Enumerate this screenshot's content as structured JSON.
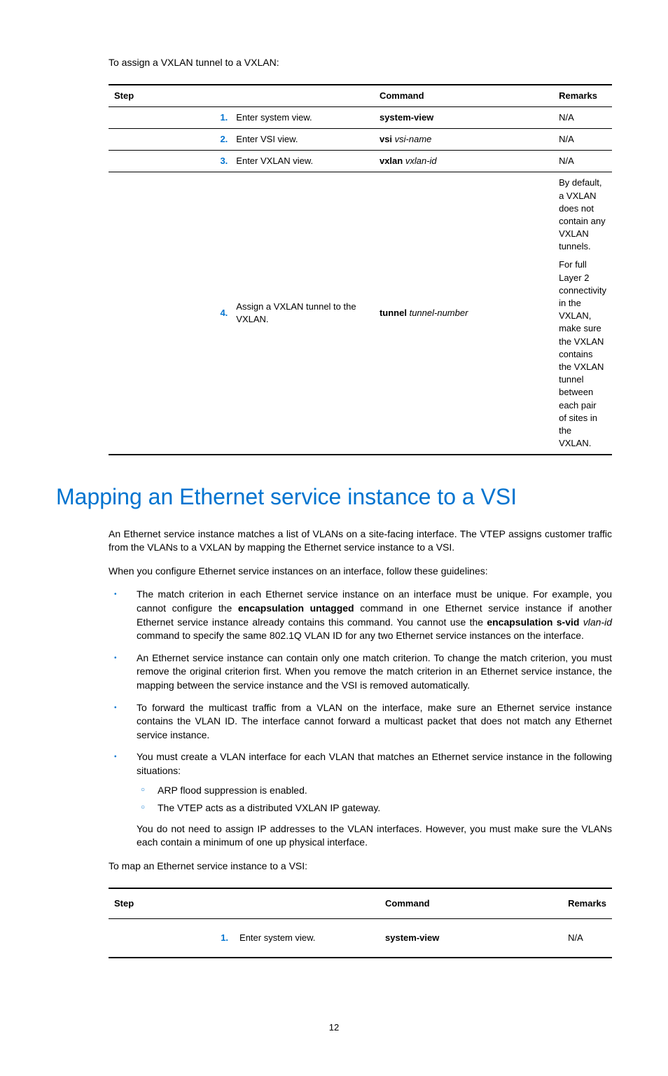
{
  "intro_text_1": "To assign a VXLAN tunnel to a VXLAN:",
  "table1": {
    "headers": {
      "step": "Step",
      "command": "Command",
      "remarks": "Remarks"
    },
    "rows": [
      {
        "num": "1.",
        "desc": "Enter system view.",
        "cmd_bold": "system-view",
        "cmd_italic": "",
        "remarks": "N/A"
      },
      {
        "num": "2.",
        "desc": "Enter VSI view.",
        "cmd_bold": "vsi",
        "cmd_italic": "vsi-name",
        "remarks": "N/A"
      },
      {
        "num": "3.",
        "desc": "Enter VXLAN view.",
        "cmd_bold": "vxlan",
        "cmd_italic": "vxlan-id",
        "remarks": "N/A"
      },
      {
        "num": "4.",
        "desc": "Assign a VXLAN tunnel to the VXLAN.",
        "cmd_bold": "tunnel",
        "cmd_italic": "tunnel-number",
        "remarks_p1": "By default, a VXLAN does not contain any VXLAN tunnels.",
        "remarks_p2": "For full Layer 2 connectivity in the VXLAN, make sure the VXLAN contains the VXLAN tunnel between each pair of sites in the VXLAN."
      }
    ]
  },
  "heading": "Mapping an Ethernet service instance to a VSI",
  "para1": "An Ethernet service instance matches a list of VLANs on a site-facing interface. The VTEP assigns customer traffic from the VLANs to a VXLAN by mapping the Ethernet service instance to a VSI.",
  "para2": "When you configure Ethernet service instances on an interface, follow these guidelines:",
  "bullet1_a": "The match criterion in each Ethernet service instance on an interface must be unique. For example, you cannot configure the ",
  "bullet1_b": "encapsulation untagged",
  "bullet1_c": " command in one Ethernet service instance if another Ethernet service instance already contains this command. You cannot use the ",
  "bullet1_d": "encapsulation s-vid",
  "bullet1_e": "vlan-id",
  "bullet1_f": " command to specify the same 802.1Q VLAN ID for any two Ethernet service instances on the interface.",
  "bullet2": "An Ethernet service instance can contain only one match criterion. To change the match criterion, you must remove the original criterion first. When you remove the match criterion in an Ethernet service instance, the mapping between the service instance and the VSI is removed automatically.",
  "bullet3": "To forward the multicast traffic from a VLAN on the interface, make sure an Ethernet service instance contains the VLAN ID. The interface cannot forward a multicast packet that does not match any Ethernet service instance.",
  "bullet4": "You must create a VLAN interface for each VLAN that matches an Ethernet service instance in the following situations:",
  "sub1": "ARP flood suppression is enabled.",
  "sub2": "The VTEP acts as a distributed VXLAN IP gateway.",
  "bullet4_after": "You do not need to assign IP addresses to the VLAN interfaces. However, you must make sure the VLANs each contain a minimum of one up physical interface.",
  "intro_text_2": "To map an Ethernet service instance to a VSI:",
  "table2": {
    "headers": {
      "step": "Step",
      "command": "Command",
      "remarks": "Remarks"
    },
    "rows": [
      {
        "num": "1.",
        "desc": "Enter system view.",
        "cmd_bold": "system-view",
        "cmd_italic": "",
        "remarks": "N/A"
      }
    ]
  },
  "page_number": "12"
}
